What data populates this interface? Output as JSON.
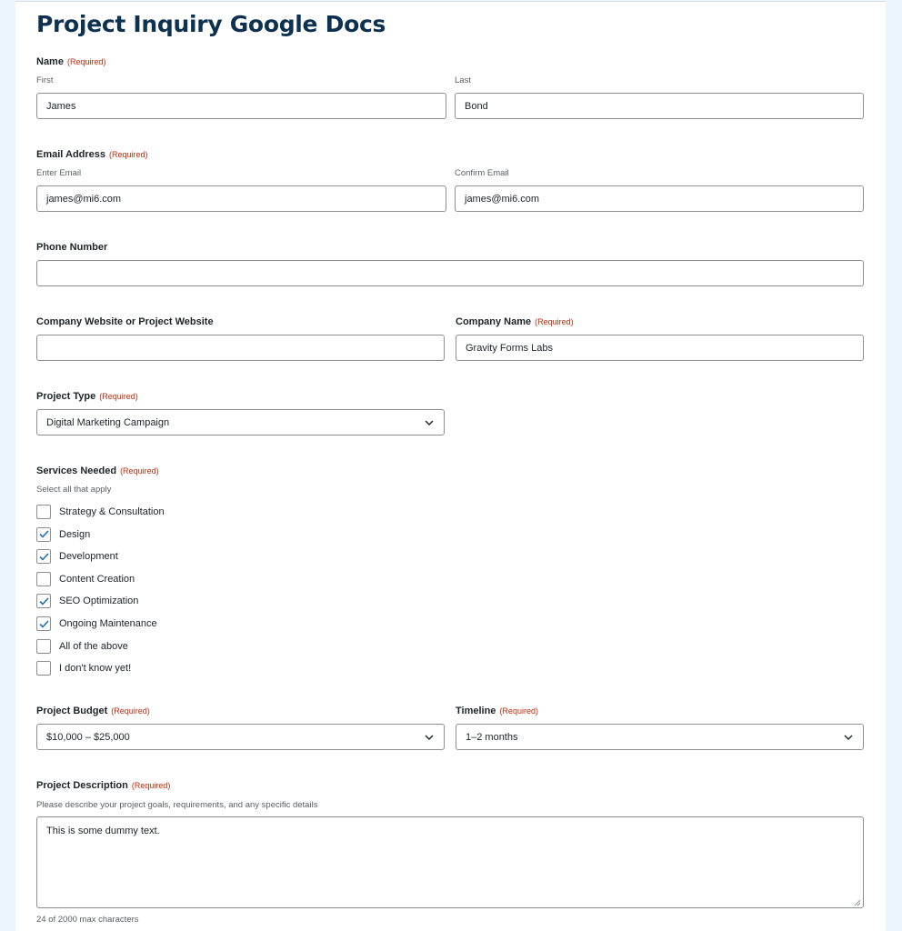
{
  "form": {
    "title": "Project Inquiry Google Docs",
    "required_text": "(Required)",
    "name": {
      "label": "Name",
      "first_label": "First",
      "first_value": "James",
      "last_label": "Last",
      "last_value": "Bond"
    },
    "email": {
      "label": "Email Address",
      "enter_label": "Enter Email",
      "enter_value": "james@mi6.com",
      "confirm_label": "Confirm Email",
      "confirm_value": "james@mi6.com"
    },
    "phone": {
      "label": "Phone Number",
      "value": ""
    },
    "website": {
      "label": "Company Website or Project Website",
      "value": ""
    },
    "company": {
      "label": "Company Name",
      "value": "Gravity Forms Labs"
    },
    "project_type": {
      "label": "Project Type",
      "value": "Digital Marketing Campaign"
    },
    "services": {
      "label": "Services Needed",
      "description": "Select all that apply",
      "items": [
        {
          "label": "Strategy & Consultation",
          "checked": false
        },
        {
          "label": "Design",
          "checked": true
        },
        {
          "label": "Development",
          "checked": true
        },
        {
          "label": "Content Creation",
          "checked": false
        },
        {
          "label": "SEO Optimization",
          "checked": true
        },
        {
          "label": "Ongoing Maintenance",
          "checked": true
        },
        {
          "label": "All of the above",
          "checked": false
        },
        {
          "label": "I don't know yet!",
          "checked": false
        }
      ]
    },
    "budget": {
      "label": "Project Budget",
      "value": "$10,000 – $25,000"
    },
    "timeline": {
      "label": "Timeline",
      "value": "1–2 months"
    },
    "description": {
      "label": "Project Description",
      "help": "Please describe your project goals, requirements, and any specific details",
      "value": "This is some dummy text.",
      "counter": "24 of 2000 max characters"
    }
  },
  "colors": {
    "title": "#0e3150",
    "required": "#c02b0a",
    "checkmark": "#2271b1",
    "page_background": "#eaf5fd"
  }
}
